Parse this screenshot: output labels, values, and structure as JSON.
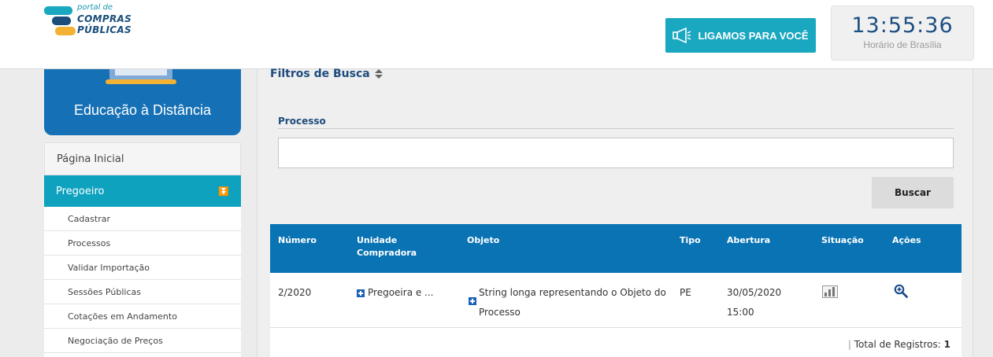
{
  "header": {
    "logo": {
      "line1": "portal de",
      "line2": "COMPRAS",
      "line3": "PÚBLICAS"
    },
    "call_button_label": "LIGAMOS PARA VOCÊ",
    "clock": {
      "time": "13:55:36",
      "label": "Horário de Brasília"
    }
  },
  "sidebar": {
    "card_title": "Educação à Distância",
    "home_label": "Página Inicial",
    "active_section": "Pregoeiro",
    "items": [
      {
        "label": "Cadastrar"
      },
      {
        "label": "Processos"
      },
      {
        "label": "Validar Importação"
      },
      {
        "label": "Sessões Públicas"
      },
      {
        "label": "Cotações em Andamento"
      },
      {
        "label": "Negociação de Preços"
      }
    ]
  },
  "filters": {
    "title": "Filtros de Busca",
    "process_label": "Processo",
    "process_value": "",
    "search_button": "Buscar"
  },
  "table": {
    "columns": [
      "Número",
      "Unidade Compradora",
      "Objeto",
      "Tipo",
      "Abertura",
      "Situação",
      "Ações"
    ],
    "rows": [
      {
        "numero": "2/2020",
        "unidade": "Pregoeira e ...",
        "objeto": "String longa representando o Objeto do Processo",
        "tipo": "PE",
        "abertura_date": "30/05/2020",
        "abertura_time": "15:00"
      }
    ],
    "total_label": "Total de Registros:",
    "total_value": "1"
  },
  "colors": {
    "header_blue": "#0a73b4",
    "accent_teal": "#1aa7c0",
    "active_menu": "#0ea2bf",
    "title_navy": "#1e4c7e"
  },
  "icons": [
    "megaphone-icon",
    "sort-icon",
    "chevron-double-down-icon",
    "expand-plus-icon",
    "status-chart-icon",
    "zoom-icon"
  ]
}
